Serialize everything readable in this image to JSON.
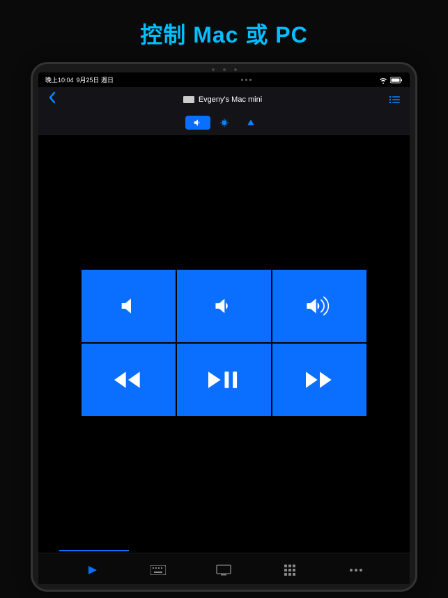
{
  "marketing": {
    "title": "控制 Mac 或 PC"
  },
  "statusBar": {
    "time": "晚上10:04",
    "date": "9月25日 週日"
  },
  "navBar": {
    "deviceName": "Evgeny's Mac mini"
  },
  "segments": {
    "items": [
      {
        "name": "volume",
        "active": true
      },
      {
        "name": "brightness",
        "active": false
      },
      {
        "name": "navigation",
        "active": false
      }
    ]
  },
  "controlGrid": {
    "buttons": [
      {
        "name": "mute",
        "icon": "volume-off"
      },
      {
        "name": "volume-down",
        "icon": "volume-low"
      },
      {
        "name": "volume-up",
        "icon": "volume-high"
      },
      {
        "name": "rewind",
        "icon": "rewind"
      },
      {
        "name": "play-pause",
        "icon": "play-pause"
      },
      {
        "name": "fast-forward",
        "icon": "fast-forward"
      }
    ]
  },
  "tabBar": {
    "items": [
      {
        "name": "play",
        "active": true
      },
      {
        "name": "keyboard",
        "active": false
      },
      {
        "name": "display",
        "active": false
      },
      {
        "name": "grid",
        "active": false
      },
      {
        "name": "more",
        "active": false
      }
    ]
  },
  "colors": {
    "accent": "#0a6eff",
    "accentBright": "#00BFFF",
    "background": "#000000"
  }
}
